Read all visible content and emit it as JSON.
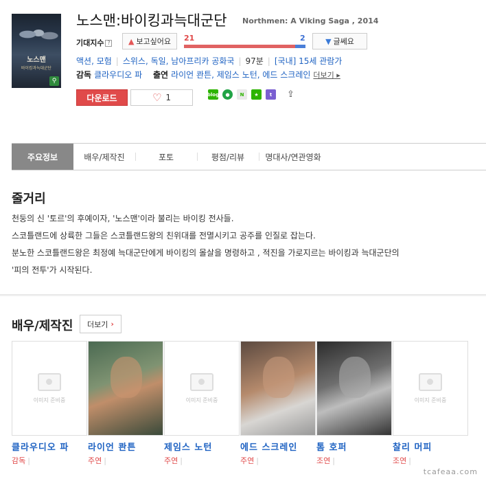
{
  "watermark_bottom": "tcafeaa.com",
  "movie": {
    "title": "노스맨:바이킹과늑대군단",
    "title_en": "Northmen: A Viking Saga , 2014",
    "poster_title": "노스맨",
    "poster_subtitle": "바이킹과늑대군단"
  },
  "expectation": {
    "label": "기대지수",
    "help": "?",
    "want_label": "보고싶어요",
    "nowant_label": "글쎄요",
    "want_count": "21",
    "nowant_count": "2",
    "want_fraction": 0.913
  },
  "meta": {
    "genre": "액션, 모험",
    "countries": "스위스, 독일, 남아프리카 공화국",
    "runtime": "97분",
    "rating": "[국내] 15세 관람가"
  },
  "credits": {
    "director_label": "감독",
    "director": "클라우디오 파",
    "cast_label": "출연",
    "cast": "라이언 콴튼, 제임스 노턴, 에드 스크레인",
    "more": "더보기"
  },
  "actions": {
    "download": "다운로드",
    "like_count": "1"
  },
  "share": {
    "blog": "blog",
    "band": "●",
    "memo": "N",
    "book": "★",
    "tumblr": "t",
    "share": "⇪"
  },
  "tabs": [
    {
      "label": "주요정보",
      "active": true
    },
    {
      "label": "배우/제작진"
    },
    {
      "label": "포토"
    },
    {
      "label": "평점/리뷰"
    },
    {
      "label": "명대사/연관영화"
    }
  ],
  "synopsis": {
    "heading": "줄거리",
    "lines": [
      "천둥의 신 '토르'의 후예이자, '노스맨'이라 불리는 바이킹 전사들.",
      " 스코틀랜드에 상륙한 그들은 스코틀랜드왕의 친위대를 전멸시키고 공주를 인질로 잡는다.",
      " 분노한 스코틀랜드왕은 최정예 늑대군단에게 바이킹의 몰살을 명령하고 , 적진을 가로지르는 바이킹과 늑대군단의",
      "'피의 전투'가 시작된다."
    ]
  },
  "cast_section": {
    "heading": "배우/제작진",
    "more": "더보기",
    "no_image_text": "이미지 준비중",
    "people": [
      {
        "name": "클라우디오 파",
        "role": "감독",
        "photo": "none"
      },
      {
        "name": "라이언 콴튼",
        "role": "주연",
        "photo": "face-1"
      },
      {
        "name": "제임스 노턴",
        "role": "주연",
        "photo": "none"
      },
      {
        "name": "에드 스크레인",
        "role": "주연",
        "photo": "face-2"
      },
      {
        "name": "톰 호퍼",
        "role": "조연",
        "photo": "face-3"
      },
      {
        "name": "찰리 머피",
        "role": "조연",
        "photo": "none"
      }
    ]
  }
}
